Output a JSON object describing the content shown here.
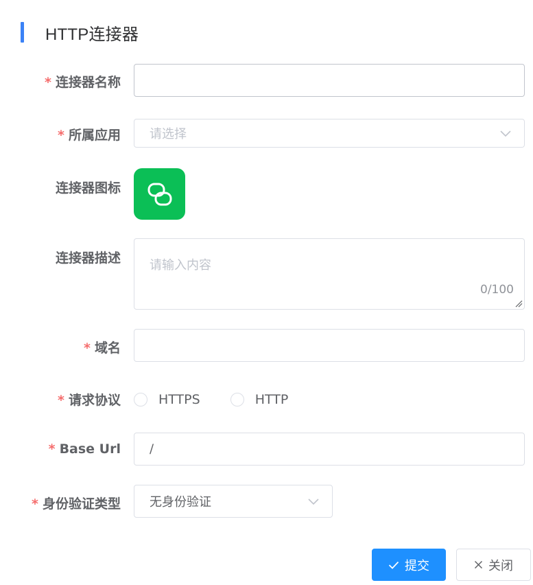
{
  "dialog": {
    "title": "HTTP连接器",
    "accent_color": "#3b82f6"
  },
  "form": {
    "name": {
      "required": "*",
      "label": "连接器名称",
      "value": ""
    },
    "app": {
      "required": "*",
      "label": "所属应用",
      "placeholder": "请选择"
    },
    "icon": {
      "label": "连接器图标",
      "icon_name": "link-chain-icon",
      "tile_color": "#0bbf56"
    },
    "description": {
      "label": "连接器描述",
      "placeholder": "请输入内容",
      "counter": "0/100"
    },
    "domain": {
      "required": "*",
      "label": "域名",
      "value": ""
    },
    "protocol": {
      "required": "*",
      "label": "请求协议",
      "options": [
        "HTTPS",
        "HTTP"
      ]
    },
    "base_url": {
      "required": "*",
      "label": "Base Url",
      "value": "/"
    },
    "auth_type": {
      "required": "*",
      "label": "身份验证类型",
      "value": "无身份验证"
    }
  },
  "footer": {
    "submit_label": "提交",
    "close_label": "关闭",
    "primary_color": "#1e90ff"
  }
}
